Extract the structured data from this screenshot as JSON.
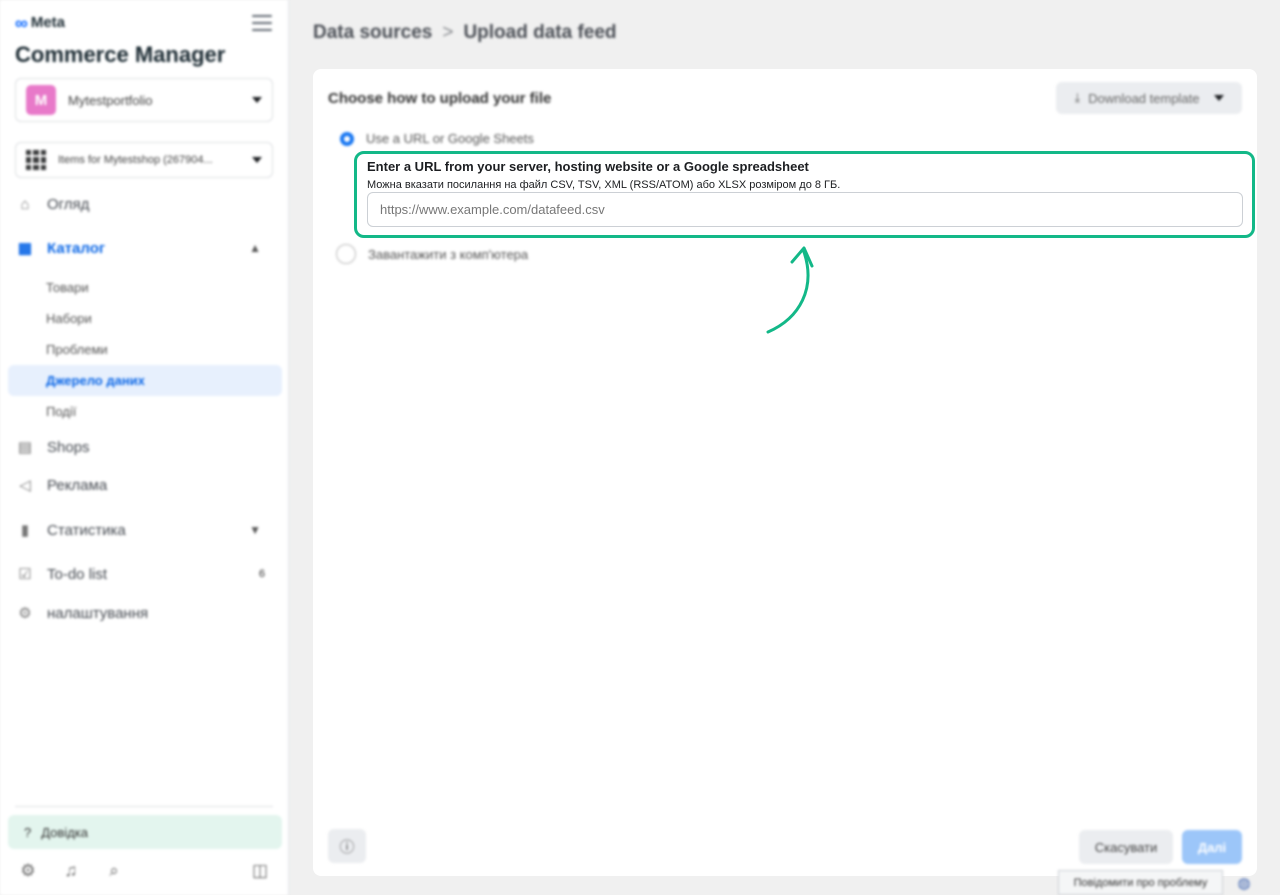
{
  "sidebar": {
    "brand": "Meta",
    "app_title": "Commerce Manager",
    "account": {
      "initial": "M",
      "name": "Mytestportfolio"
    },
    "catalog": {
      "name": "Items for Mytestshop (267904..."
    },
    "nav": {
      "overview": "Огляд",
      "catalog": "Каталог",
      "catalog_sub": [
        "Товари",
        "Набори",
        "Проблеми",
        "Джерело даних",
        "Події"
      ],
      "shops": "Shops",
      "ads": "Реклама",
      "stats": "Статистика",
      "todo": "To-do list",
      "todo_count": "6",
      "settings": "налаштування"
    },
    "help": "Довідка"
  },
  "breadcrumb": {
    "parent": "Data sources",
    "separator": ">",
    "current": "Upload data feed"
  },
  "card": {
    "title": "Choose how to upload your file",
    "download_template": "Download template",
    "option_url": "Use a URL or Google Sheets",
    "url_section": {
      "title": "Enter a URL from your server, hosting website or a Google spreadsheet",
      "description": "Можна вказати посилання на файл CSV, TSV, XML (RSS/ATOM) або XLSX розміром до 8 ГБ.",
      "placeholder": "https://www.example.com/datafeed.csv"
    },
    "option_upload": "Завантажити з комп'ютера",
    "cancel": "Скасувати",
    "next": "Далі"
  },
  "footer": {
    "report_problem": "Повідомити про проблему"
  },
  "colors": {
    "highlight": "#13b888",
    "accent": "#1877f2",
    "active_nav": "#0a66e6"
  }
}
